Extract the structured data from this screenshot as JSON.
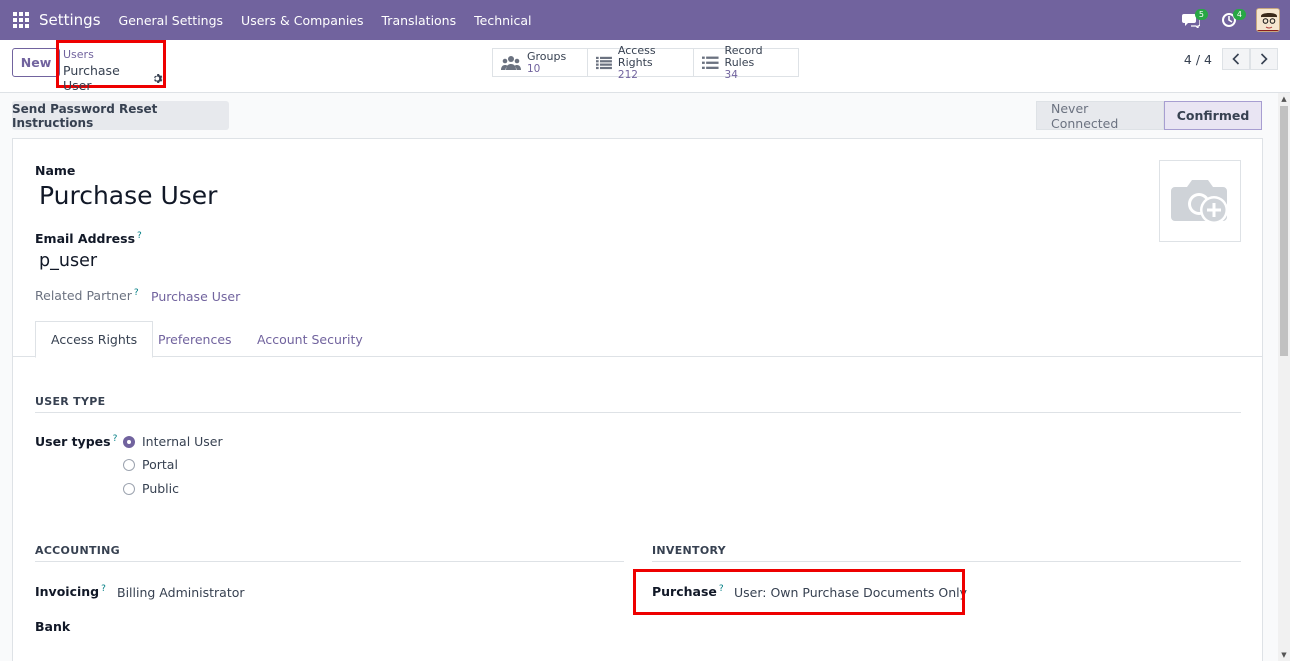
{
  "navbar": {
    "brand": "Settings",
    "menu": [
      "General Settings",
      "Users & Companies",
      "Translations",
      "Technical"
    ],
    "messages_badge": "5",
    "activities_badge": "4"
  },
  "control_panel": {
    "new_label": "New",
    "breadcrumb_parent": "Users",
    "breadcrumb_current": "Purchase User",
    "smart_buttons": {
      "groups": {
        "label": "Groups",
        "value": "10"
      },
      "access_rights": {
        "label": "Access Rights",
        "value": "212"
      },
      "record_rules": {
        "label": "Record Rules",
        "value": "34"
      }
    },
    "pager": "4 / 4"
  },
  "actions": {
    "reset_password": "Send Password Reset Instructions"
  },
  "statusbar": {
    "stages": [
      "Never Connected",
      "Confirmed"
    ],
    "active": "Confirmed"
  },
  "form": {
    "name_label": "Name",
    "name_value": "Purchase User",
    "email_label": "Email Address",
    "email_help": "?",
    "email_value": "p_user",
    "related_partner_label": "Related Partner",
    "related_partner_help": "?",
    "related_partner_value": "Purchase User"
  },
  "tabs": [
    "Access Rights",
    "Preferences",
    "Account Security"
  ],
  "access_rights": {
    "user_type_title": "USER TYPE",
    "user_types_label": "User types",
    "user_types_help": "?",
    "user_types_options": [
      "Internal User",
      "Portal",
      "Public"
    ],
    "user_types_selected": "Internal User",
    "accounting_title": "ACCOUNTING",
    "invoicing_label": "Invoicing",
    "invoicing_help": "?",
    "invoicing_value": "Billing Administrator",
    "bank_label": "Bank",
    "inventory_title": "INVENTORY",
    "purchase_label": "Purchase",
    "purchase_help": "?",
    "purchase_value": "User: Own Purchase Documents Only"
  },
  "colors": {
    "brand": "#71639e",
    "highlight": "#ee0000"
  }
}
